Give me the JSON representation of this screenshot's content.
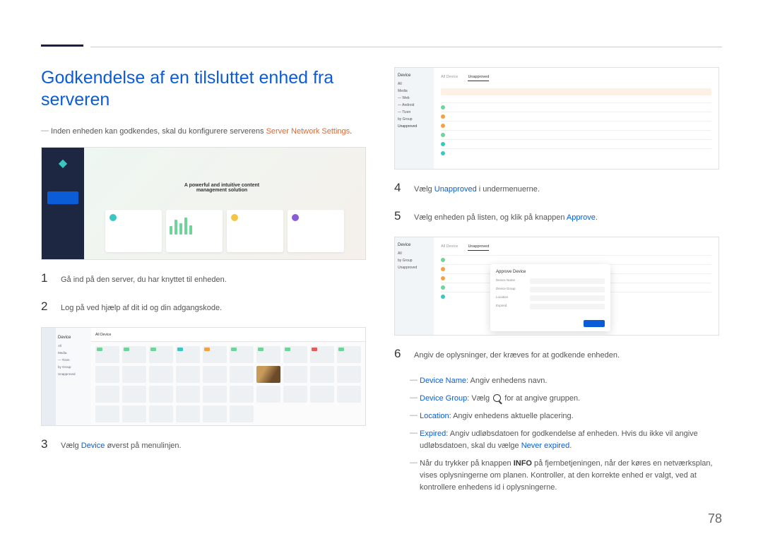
{
  "page_number": "78",
  "title": "Godkendelse af en tilsluttet enhed fra serveren",
  "note_pre": "Inden enheden kan godkendes, skal du konfigurere serverens",
  "note_highlight": "Server Network Settings",
  "screenshot1": {
    "caption": "A powerful and intuitive content\nmanagement solution"
  },
  "steps": {
    "s1": "Gå ind på den server, du har knyttet til enheden.",
    "s2": "Log på ved hjælp af dit id og din adgangskode.",
    "s3_pre": "Vælg",
    "s3_hl": "Device",
    "s3_post": "øverst på menulinjen.",
    "s4_pre": "Vælg",
    "s4_hl": "Unapproved",
    "s4_post": "i undermenuerne.",
    "s5_pre": "Vælg enheden på listen, og klik på knappen",
    "s5_hl": "Approve",
    "s6": "Angiv de oplysninger, der kræves for at godkende enheden."
  },
  "device_sidebar": {
    "title": "Device",
    "items": [
      "All",
      "Media",
      "— Web",
      "— Android",
      "— Tizen",
      "by Group",
      "Unapproved"
    ]
  },
  "tabs": {
    "all": "All Device",
    "unapproved": "Unapproved"
  },
  "popup": {
    "title": "Approve Device",
    "f1": "Device Name",
    "f2": "Device Group",
    "f3": "Location",
    "f4": "Expired"
  },
  "bullets": {
    "b1_hl": "Device Name",
    "b1_txt": ": Angiv enhedens navn.",
    "b2_hl": "Device Group",
    "b2_pre": ": Vælg",
    "b2_post": "for at angive gruppen.",
    "b3_hl": "Location",
    "b3_txt": ": Angiv enhedens aktuelle placering.",
    "b4_hl": "Expired",
    "b4_txt": ": Angiv udløbsdatoen for godkendelse af enheden. Hvis du ikke vil angive udløbsdatoen, skal du vælge",
    "b4_hl2": "Never expired",
    "b5_pre": "Når du trykker på knappen",
    "b5_strong": "INFO",
    "b5_post": "på fjernbetjeningen, når der køres en netværksplan, vises oplysningerne om planen. Kontroller, at den korrekte enhed er valgt, ved at kontrollere enhedens id i oplysningerne."
  }
}
